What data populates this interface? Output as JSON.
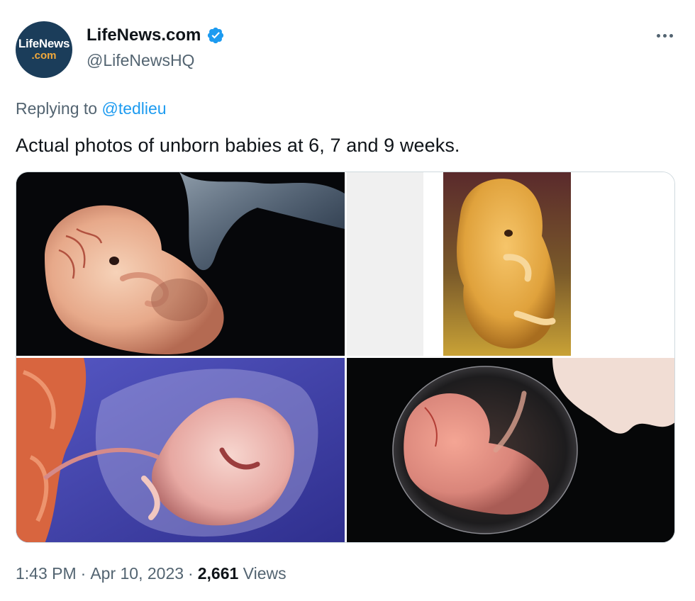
{
  "author": {
    "avatar_line1": "LifeNews",
    "avatar_line2": ".com",
    "display_name": "LifeNews.com",
    "handle": "@LifeNewsHQ",
    "verified": true
  },
  "reply": {
    "prefix": "Replying to",
    "mention": "@tedlieu"
  },
  "tweet_text": "Actual photos of unborn babies at 6, 7 and 9 weeks.",
  "media": {
    "count": 4
  },
  "meta": {
    "time": "1:43 PM",
    "date": "Apr 10, 2023",
    "views_count": "2,661",
    "views_label": "Views",
    "separator": "·"
  },
  "colors": {
    "accent": "#1d9bf0",
    "secondary_text": "#536471",
    "primary_text": "#0f1419",
    "border": "#cfd9de"
  },
  "icons": {
    "verified": "verified-badge-icon",
    "more": "more-options-icon"
  }
}
